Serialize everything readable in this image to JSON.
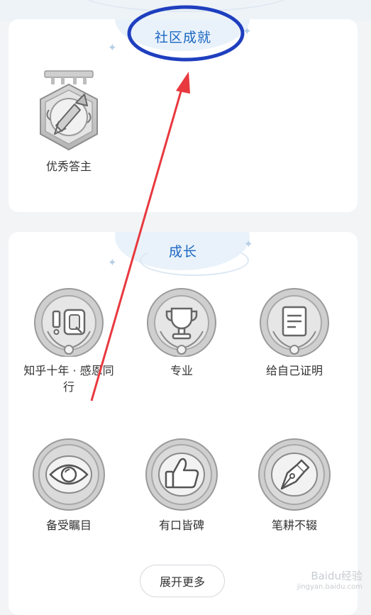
{
  "community_section": {
    "title": "社区成就",
    "badges": [
      {
        "label": "优秀答主",
        "icon": "pen-medal-icon"
      }
    ]
  },
  "growth_section": {
    "title": "成长",
    "badges": [
      {
        "label": "知乎十年 · 感恩同行",
        "icon": "ten-years-icon"
      },
      {
        "label": "专业",
        "icon": "trophy-icon"
      },
      {
        "label": "给自己证明",
        "icon": "document-icon"
      },
      {
        "label": "备受瞩目",
        "icon": "eye-icon"
      },
      {
        "label": "有口皆碑",
        "icon": "thumbs-up-icon"
      },
      {
        "label": "笔耕不辍",
        "icon": "fountain-pen-icon"
      }
    ],
    "expand_button": "展开更多"
  },
  "watermark": {
    "brand": "Baidu经验",
    "url": "jingyan.baidu.com"
  },
  "colors": {
    "accent": "#1a66c2",
    "annotation": "#e8393f",
    "highlight": "#1f3fbf"
  }
}
